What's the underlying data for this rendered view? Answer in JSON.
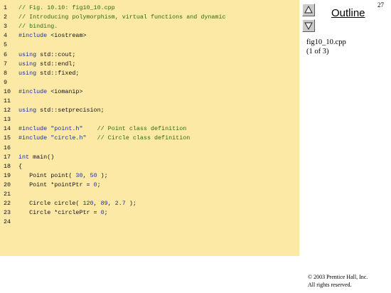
{
  "code": {
    "lines": [
      {
        "n": "1",
        "segments": [
          {
            "t": "// Fig. 10.10: fig10_10.cpp",
            "c": "com"
          }
        ]
      },
      {
        "n": "2",
        "segments": [
          {
            "t": "// Introducing polymorphism, virtual functions and dynamic",
            "c": "com"
          }
        ]
      },
      {
        "n": "3",
        "segments": [
          {
            "t": "// binding.",
            "c": "com"
          }
        ]
      },
      {
        "n": "4",
        "segments": [
          {
            "t": "#include",
            "c": "kw"
          },
          {
            "t": " <iostream>",
            "c": ""
          }
        ]
      },
      {
        "n": "5",
        "segments": []
      },
      {
        "n": "6",
        "segments": [
          {
            "t": "using",
            "c": "kw"
          },
          {
            "t": " std::cout;",
            "c": ""
          }
        ]
      },
      {
        "n": "7",
        "segments": [
          {
            "t": "using",
            "c": "kw"
          },
          {
            "t": " std::endl;",
            "c": ""
          }
        ]
      },
      {
        "n": "8",
        "segments": [
          {
            "t": "using",
            "c": "kw"
          },
          {
            "t": " std::fixed;",
            "c": ""
          }
        ]
      },
      {
        "n": "9",
        "segments": []
      },
      {
        "n": "10",
        "segments": [
          {
            "t": "#include",
            "c": "kw"
          },
          {
            "t": " <iomanip>",
            "c": ""
          }
        ]
      },
      {
        "n": "11",
        "segments": []
      },
      {
        "n": "12",
        "segments": [
          {
            "t": "using",
            "c": "kw"
          },
          {
            "t": " std::setprecision;",
            "c": ""
          }
        ]
      },
      {
        "n": "13",
        "segments": []
      },
      {
        "n": "14",
        "segments": [
          {
            "t": "#include",
            "c": "kw"
          },
          {
            "t": " ",
            "c": ""
          },
          {
            "t": "\"point.h\"",
            "c": "str"
          },
          {
            "t": "    ",
            "c": ""
          },
          {
            "t": "// Point class definition",
            "c": "com"
          }
        ]
      },
      {
        "n": "15",
        "segments": [
          {
            "t": "#include",
            "c": "kw"
          },
          {
            "t": " ",
            "c": ""
          },
          {
            "t": "\"circle.h\"",
            "c": "str"
          },
          {
            "t": "   ",
            "c": ""
          },
          {
            "t": "// Circle class definition",
            "c": "com"
          }
        ]
      },
      {
        "n": "16",
        "segments": []
      },
      {
        "n": "17",
        "segments": [
          {
            "t": "int",
            "c": "kw"
          },
          {
            "t": " main()",
            "c": ""
          }
        ]
      },
      {
        "n": "18",
        "segments": [
          {
            "t": "{",
            "c": ""
          }
        ]
      },
      {
        "n": "19",
        "segments": [
          {
            "t": "   Point point( ",
            "c": ""
          },
          {
            "t": "30",
            "c": "num"
          },
          {
            "t": ", ",
            "c": ""
          },
          {
            "t": "50",
            "c": "num"
          },
          {
            "t": " );",
            "c": ""
          }
        ]
      },
      {
        "n": "20",
        "segments": [
          {
            "t": "   Point *pointPtr = ",
            "c": ""
          },
          {
            "t": "0",
            "c": "num"
          },
          {
            "t": ";",
            "c": ""
          }
        ]
      },
      {
        "n": "21",
        "segments": []
      },
      {
        "n": "22",
        "segments": [
          {
            "t": "   Circle circle( ",
            "c": ""
          },
          {
            "t": "120",
            "c": "num"
          },
          {
            "t": ", ",
            "c": ""
          },
          {
            "t": "89",
            "c": "num"
          },
          {
            "t": ", ",
            "c": ""
          },
          {
            "t": "2.7",
            "c": "num"
          },
          {
            "t": " );",
            "c": ""
          }
        ]
      },
      {
        "n": "23",
        "segments": [
          {
            "t": "   Circle *circlePtr = ",
            "c": ""
          },
          {
            "t": "0",
            "c": "num"
          },
          {
            "t": ";",
            "c": ""
          }
        ]
      },
      {
        "n": "24",
        "segments": []
      }
    ]
  },
  "sidebar": {
    "outline_label": "Outline",
    "page_number": "27",
    "file_name": "fig10_10.cpp",
    "file_pages": "(1 of 3)",
    "nav_up_icon": "triangle-up-icon",
    "nav_down_icon": "triangle-down-icon"
  },
  "footer": {
    "copyright": "© 2003 Prentice Hall, Inc.",
    "rights": "All rights reserved."
  },
  "colors": {
    "code_background": "#fde9a6",
    "comment": "#2d6b12",
    "keyword": "#1c2f9e"
  }
}
